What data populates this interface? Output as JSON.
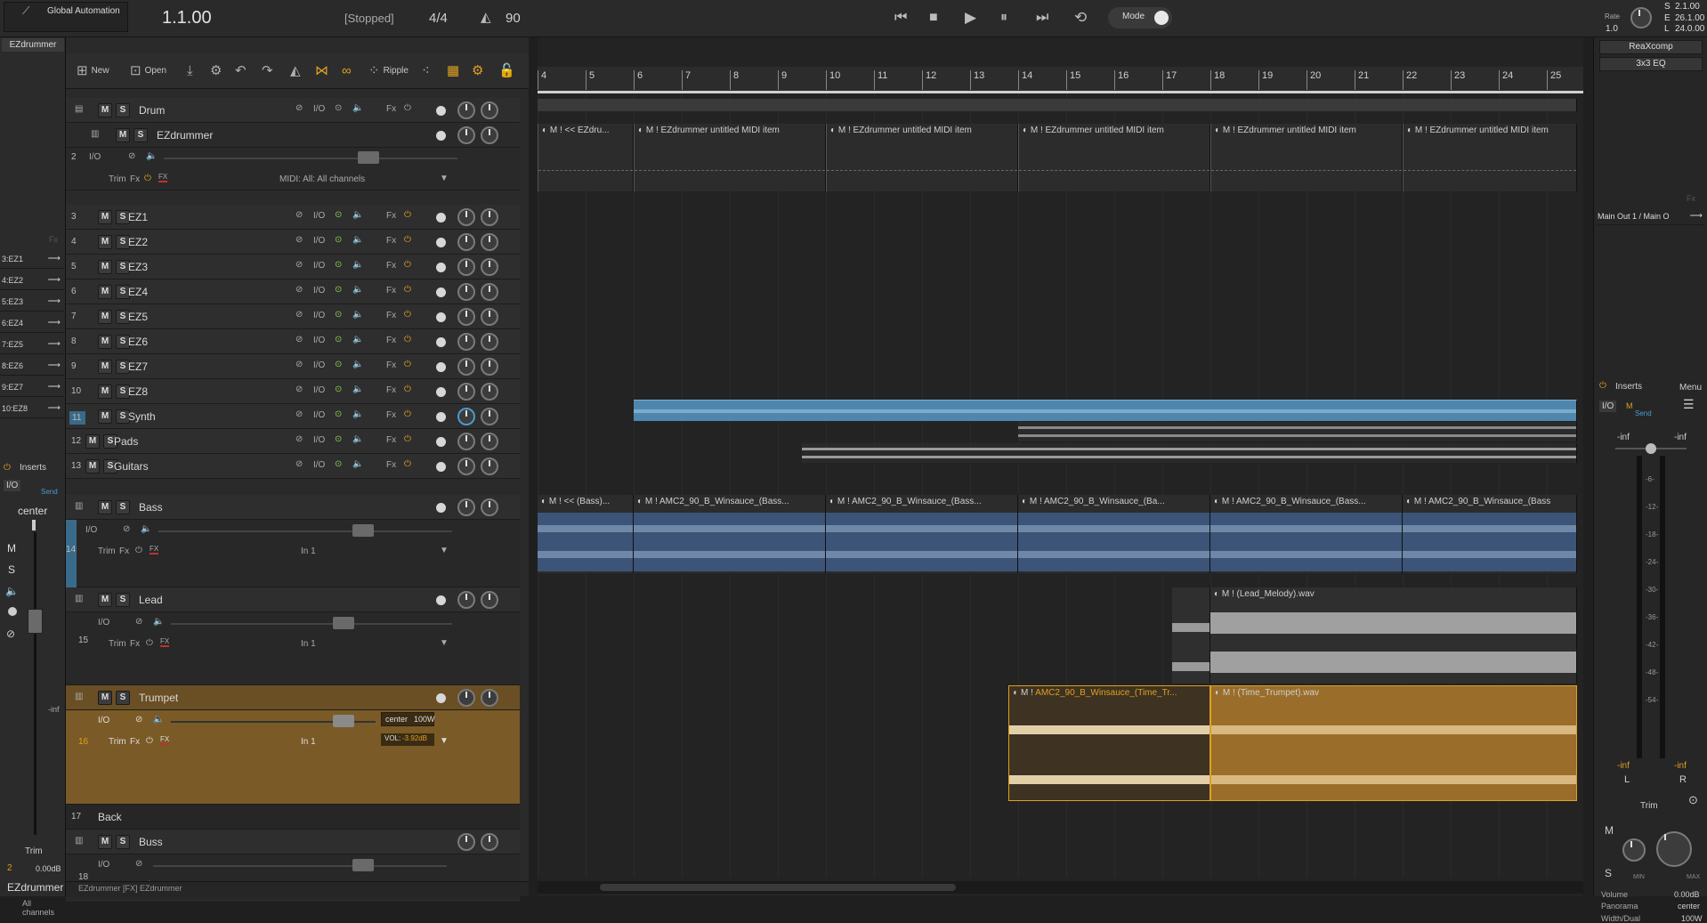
{
  "app": {
    "automation_label": "Global Automation",
    "position": "1.1.00",
    "status": "[Stopped]",
    "time_signature": "4/4",
    "tempo": "90",
    "mode_label": "Mode",
    "rate_label": "Rate",
    "rate_value": "1.0",
    "time_s": "2.1.00",
    "time_e": "26.1.00",
    "time_l": "24.0.00",
    "s_label": "S",
    "e_label": "E",
    "l_label": "L"
  },
  "left_strip": {
    "instrument_title": "EZdrummer",
    "sends": [
      "3:EZ1",
      "4:EZ2",
      "5:EZ3",
      "6:EZ4",
      "7:EZ5",
      "8:EZ6",
      "9:EZ7",
      "10:EZ8"
    ],
    "inserts_label": "Inserts",
    "io_label": "I/O",
    "send_label": "Send",
    "pan": "center",
    "mute": "M",
    "solo": "S",
    "inf_label": "-inf",
    "trim_label": "Trim",
    "track_num": "2",
    "gain": "0.00dB",
    "name": "EZdrummer",
    "channel": "All channels",
    "fx_label": "Fx"
  },
  "toolbar": {
    "new_label": "New",
    "open_label": "Open",
    "ripple_label": "Ripple"
  },
  "tracks": [
    {
      "num": "",
      "name": "Drum"
    },
    {
      "num": "",
      "name": "EZdrummer"
    },
    {
      "num": "2",
      "name": ""
    },
    {
      "num": "3",
      "name": "EZ1"
    },
    {
      "num": "4",
      "name": "EZ2"
    },
    {
      "num": "5",
      "name": "EZ3"
    },
    {
      "num": "6",
      "name": "EZ4"
    },
    {
      "num": "7",
      "name": "EZ5"
    },
    {
      "num": "8",
      "name": "EZ6"
    },
    {
      "num": "9",
      "name": "EZ7"
    },
    {
      "num": "10",
      "name": "EZ8"
    },
    {
      "num": "11",
      "name": "Synth"
    },
    {
      "num": "12",
      "name": "Pads"
    },
    {
      "num": "13",
      "name": "Guitars"
    },
    {
      "num": "",
      "name": "Bass"
    },
    {
      "num": "14",
      "name": ""
    },
    {
      "num": "",
      "name": "Lead"
    },
    {
      "num": "15",
      "name": ""
    },
    {
      "num": "",
      "name": "Trumpet"
    },
    {
      "num": "16",
      "name": ""
    },
    {
      "num": "17",
      "name": "Back"
    },
    {
      "num": "",
      "name": "Buss"
    },
    {
      "num": "18",
      "name": ""
    }
  ],
  "track_controls": {
    "mute": "M",
    "solo": "S",
    "io": "I/O",
    "fx": "Fx",
    "trim": "Trim",
    "fx_tag": "FX",
    "midi_input": "MIDI: All: All channels",
    "audio_input": "In 1",
    "pan_center": "center",
    "width": "100W",
    "vol_label": "VOL:",
    "vol_value": "-3.92dB"
  },
  "ruler_bars": [
    "4",
    "5",
    "6",
    "7",
    "8",
    "9",
    "10",
    "11",
    "12",
    "13",
    "14",
    "15",
    "16",
    "17",
    "18",
    "19",
    "20",
    "21",
    "22",
    "23",
    "24",
    "25"
  ],
  "items": {
    "ezd_first": "<< EZdru...",
    "ezd": "EZdrummer untitled MIDI item",
    "bass_first": "<< (Bass)...",
    "bass": "AMC2_90_B_Winsauce_(Bass...",
    "bass_mid": "AMC2_90_B_Winsauce_(Ba...",
    "bass_last": "AMC2_90_B_Winsauce_(Bass",
    "lead": "(Lead_Melody).wav",
    "trumpet_a": "AMC2_90_B_Winsauce_(Time_Tr...",
    "trumpet_b": "(Time_Trumpet).wav",
    "item_m": "M",
    "item_bang": "!"
  },
  "right_panel": {
    "fx1": "ReaXcomp",
    "fx2": "3x3 EQ",
    "fx_label": "Fx",
    "output": "Main Out 1 / Main O",
    "inserts_label": "Inserts",
    "menu_label": "Menu",
    "io_label": "I/O",
    "m_label": "M",
    "send_label": "Send",
    "inf_l": "-inf",
    "inf_r": "-inf",
    "scale": [
      "-6-",
      "-12-",
      "-18-",
      "-24-",
      "-30-",
      "-36-",
      "-42-",
      "-48-",
      "-54-"
    ],
    "peak_l": "-inf",
    "peak_r": "-inf",
    "l_label": "L",
    "r_label": "R",
    "trim_label": "Trim",
    "mute": "M",
    "solo": "S",
    "min_label": "MIN",
    "max_label": "MAX",
    "volume_label": "Volume",
    "volume_value": "0.00dB",
    "panorama_label": "Panorama",
    "panorama_value": "center",
    "width_label": "Width/Dual",
    "width_value": "100W"
  },
  "status_bar": {
    "text": "EZdrummer [FX] EZdrummer"
  },
  "colors": {
    "accent_orange": "#e0a020",
    "trumpet_bg": "#7a5a26",
    "bass_item": "#3b5477",
    "synth_item": "#4f86ad",
    "selected_track": "#3a6a8a"
  }
}
